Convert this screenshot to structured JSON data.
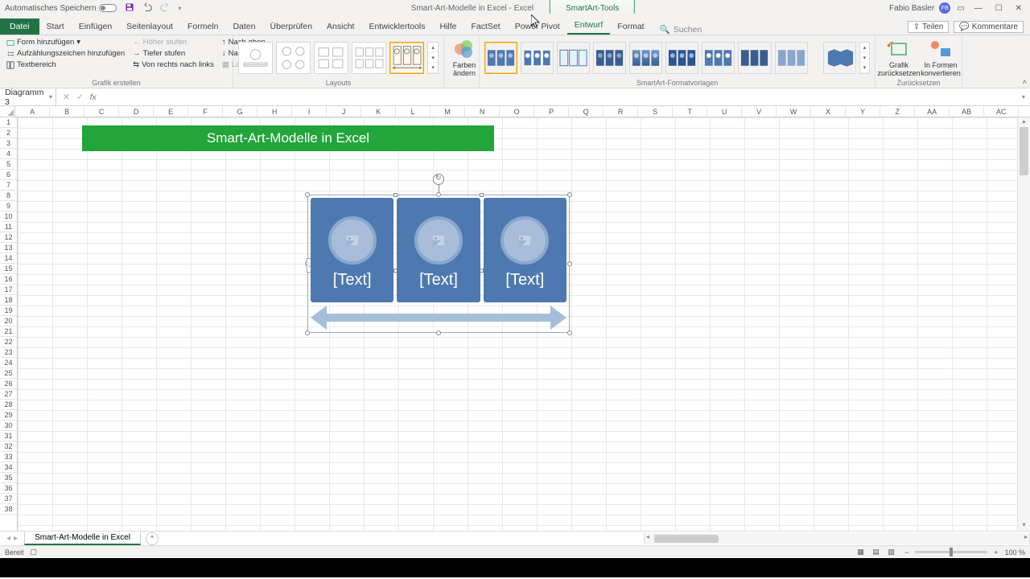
{
  "titlebar": {
    "autosave_label": "Automatisches Speichern",
    "doc_title": "Smart-Art-Modelle in Excel  -  Excel",
    "context_tab": "SmartArt-Tools",
    "user_name": "Fabio Basler",
    "user_initials": "FB"
  },
  "tabs": {
    "file": "Datei",
    "items": [
      "Start",
      "Einfügen",
      "Seitenlayout",
      "Formeln",
      "Daten",
      "Überprüfen",
      "Ansicht",
      "Entwicklertools",
      "Hilfe",
      "FactSet",
      "Power Pivot",
      "Entwurf",
      "Format"
    ],
    "active_index": 11,
    "search_placeholder": "Suchen",
    "share": "Teilen",
    "comments": "Kommentare"
  },
  "ribbon": {
    "create": {
      "add_shape": "Form hinzufügen",
      "add_bullet": "Aufzählungszeichen hinzufügen",
      "text_pane": "Textbereich",
      "promote": "Höher stufen",
      "demote": "Tiefer stufen",
      "rtl": "Von rechts nach links",
      "move_up": "Nach oben",
      "move_down": "Nach unten",
      "layout_btn": "Layout",
      "group_label": "Grafik erstellen"
    },
    "layouts_label": "Layouts",
    "change_colors": "Farben ändern",
    "styles_label": "SmartArt-Formatvorlagen",
    "reset": {
      "reset_graphic": "Grafik zurücksetzen",
      "convert": "In Formen konvertieren",
      "group_label": "Zurücksetzen"
    }
  },
  "formula_bar": {
    "name_box": "Diagramm 3"
  },
  "columns": [
    "A",
    "B",
    "C",
    "D",
    "E",
    "F",
    "G",
    "H",
    "I",
    "J",
    "K",
    "L",
    "M",
    "N",
    "O",
    "P",
    "Q",
    "R",
    "S",
    "T",
    "U",
    "V",
    "W",
    "X",
    "Y",
    "Z",
    "AA",
    "AB",
    "AC"
  ],
  "row_count": 38,
  "banner_text": "Smart-Art-Modelle in Excel",
  "smartart": {
    "cards": [
      "[Text]",
      "[Text]",
      "[Text]"
    ]
  },
  "sheet": {
    "name": "Smart-Art-Modelle in Excel"
  },
  "status": {
    "ready": "Bereit",
    "zoom": "100 %"
  }
}
